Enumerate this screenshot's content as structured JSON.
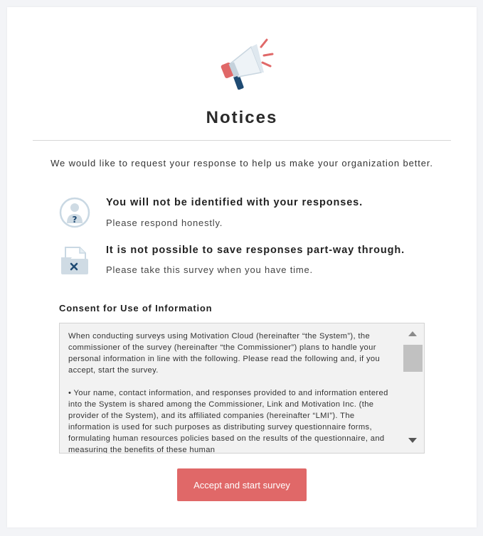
{
  "page": {
    "title": "Notices",
    "intro": "We would like to request your response to help us make your organization better."
  },
  "notices": [
    {
      "icon": "anonymous-person-icon",
      "title": "You will not be identified with your responses.",
      "subtitle": "Please respond honestly."
    },
    {
      "icon": "no-save-file-icon",
      "title": "It is not possible to save responses part-way through.",
      "subtitle": "Please take this survey when you have time."
    }
  ],
  "consent": {
    "label": "Consent for Use of Information",
    "paragraphs": [
      "When conducting surveys using Motivation Cloud (hereinafter “the System”), the commissioner of the survey (hereinafter “the Commissioner”) plans to handle your personal information in line with the following. Please read the following and, if you accept, start the survey.",
      "• Your name, contact information, and responses provided to and information entered into the System is shared among the Commissioner, Link and Motivation Inc. (the provider of the System), and its affiliated companies (hereinafter “LMI”). The information is used for such purposes as distributing survey questionnaire forms, formulating human resources policies based on the results of the questionnaire, and measuring the benefits of these human"
    ]
  },
  "actions": {
    "accept_label": "Accept and start survey"
  },
  "colors": {
    "accent": "#e06868",
    "icon_blue": "#1f4b73",
    "icon_light": "#d8e4ec"
  }
}
